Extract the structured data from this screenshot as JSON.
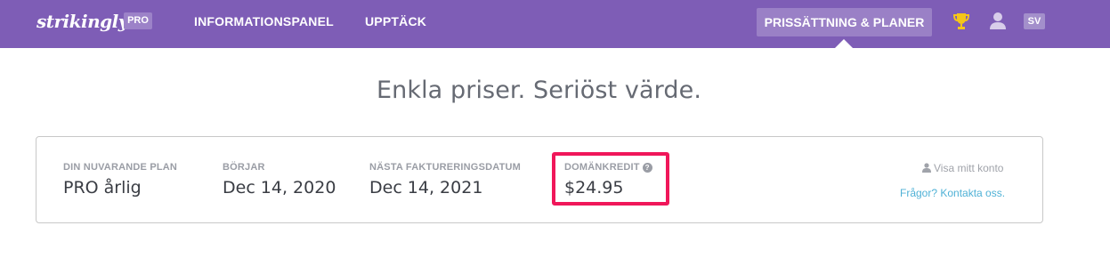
{
  "navbar": {
    "logo": "strikingly",
    "plan_badge": "PRO",
    "links": [
      "INFORMATIONSPANEL",
      "UPPTÄCK"
    ],
    "pricing_link": "PRISSÄTTNING & PLANER",
    "language": "SV",
    "icons": [
      "trophy-icon",
      "user-icon"
    ]
  },
  "headline": "Enkla priser. Seriöst värde.",
  "plan_card": {
    "current_plan": {
      "label": "DIN NUVARANDE PLAN",
      "value": "PRO årlig"
    },
    "starts": {
      "label": "BÖRJAR",
      "value": "Dec 14, 2020"
    },
    "next_billing": {
      "label": "NÄSTA FAKTURERINGSDATUM",
      "value": "Dec 14, 2021"
    },
    "domain_credit": {
      "label": "DOMÄNKREDIT",
      "value": "$24.95",
      "help_glyph": "?"
    },
    "view_account": "Visa mitt konto",
    "contact": "Frågor? Kontakta oss."
  },
  "colors": {
    "navbar_bg": "#7e5db6",
    "highlight_border": "#f0175a",
    "link": "#4fb1d6",
    "trophy": "#f5c518"
  }
}
